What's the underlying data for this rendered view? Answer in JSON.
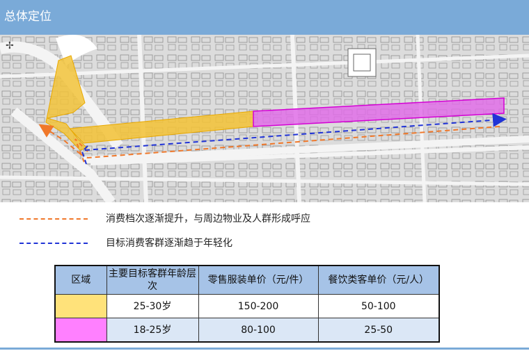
{
  "header": {
    "title": "总体定位"
  },
  "legend": [
    {
      "text": "消费档次逐渐提升，与周边物业及人群形成呼应",
      "color": "#f0782a"
    },
    {
      "text": "目标消费客群逐渐趋于年轻化",
      "color": "#2033d6"
    }
  ],
  "map": {
    "yellow_zone_color": "#f2c33a",
    "magenta_zone_color": "#e06ae8",
    "arrow_orange": "#f0782a",
    "arrow_blue": "#2033d6"
  },
  "table": {
    "headers": [
      "区域",
      "主要目标客群年龄层次",
      "零售服装单价（元/件）",
      "餐饮类客单价（元/人）"
    ],
    "rows": [
      {
        "swatch": "#ffe27a",
        "age": "25-30岁",
        "retail": "150-200",
        "dining": "50-100"
      },
      {
        "swatch": "#ff80ff",
        "age": "18-25岁",
        "retail": "80-100",
        "dining": "25-50"
      }
    ]
  }
}
